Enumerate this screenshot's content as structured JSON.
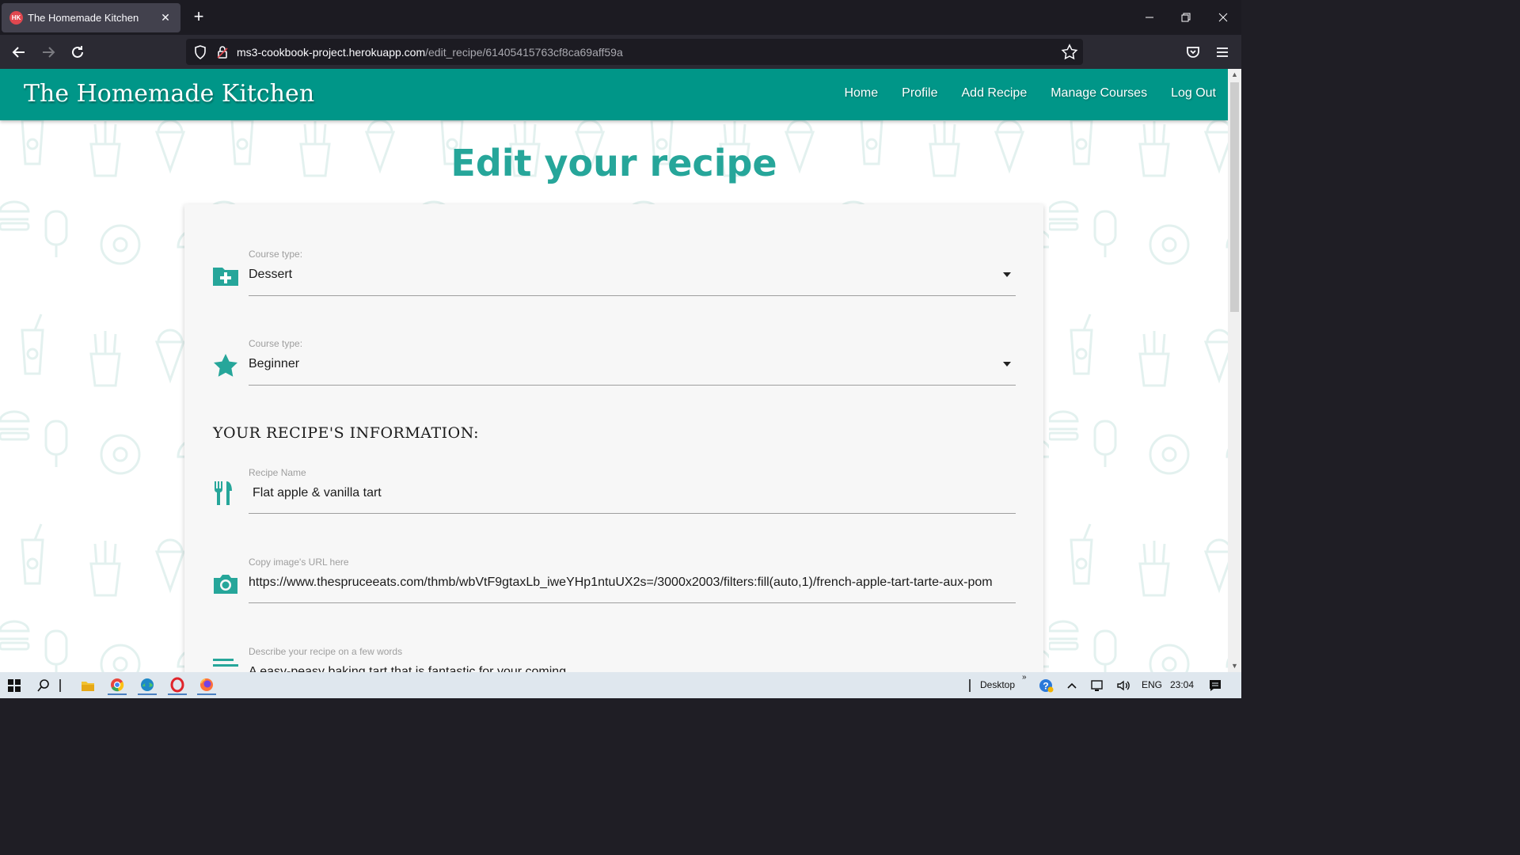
{
  "browser": {
    "tab_title": "The Homemade Kitchen",
    "url_host": "ms3-cookbook-project.herokuapp.com",
    "url_path": "/edit_recipe/61405415763cf8ca69aff59a"
  },
  "site": {
    "brand": "The Homemade Kitchen",
    "nav": [
      "Home",
      "Profile",
      "Add Recipe",
      "Manage Courses",
      "Log Out"
    ]
  },
  "page": {
    "title": "Edit your recipe",
    "section_heading": "YOUR RECIPE'S INFORMATION:"
  },
  "form": {
    "course": {
      "label": "Course type:",
      "value": "Dessert"
    },
    "difficulty": {
      "label": "Course type:",
      "value": "Beginner"
    },
    "recipe_name": {
      "label": "Recipe Name",
      "value": "Flat apple & vanilla tart"
    },
    "image_url": {
      "label": "Copy image's URL here",
      "value": "https://www.thespruceeats.com/thmb/wbVtF9gtaxLb_iweYHp1ntuUX2s=/3000x2003/filters:fill(auto,1)/french-apple-tart-tarte-aux-pom"
    },
    "description": {
      "label": "Describe your recipe on a few words",
      "value": "A easy-peasy baking tart that is fantastic for your coming"
    }
  },
  "taskbar": {
    "desktop_label": "Desktop",
    "language": "ENG",
    "time": "23:04"
  },
  "colors": {
    "primary": "#009688",
    "accent": "#26a69a"
  }
}
